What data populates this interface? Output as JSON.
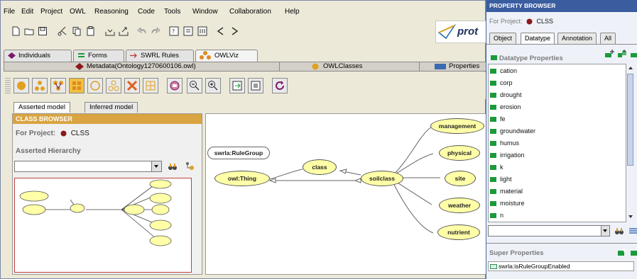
{
  "menu": [
    "File",
    "Edit",
    "Project",
    "OWL",
    "Reasoning",
    "Code",
    "Tools",
    "Window",
    "Collaboration",
    "Help"
  ],
  "logo_text": "prot",
  "tabs": [
    {
      "label": "Individuals",
      "color": "#7a1a6a"
    },
    {
      "label": "Forms",
      "color": "#1a9a3a"
    },
    {
      "label": "SWRL Rules",
      "color": "#c03030"
    },
    {
      "label": "OWLViz",
      "color": "#e08a20"
    }
  ],
  "tabs2": [
    {
      "label": "Metadata(Ontology1270600106.owl)",
      "color": "#8a1a1a"
    },
    {
      "label": "OWLClasses",
      "color": "#e0a020"
    },
    {
      "label": "Properties",
      "color": "#3a6ab0"
    }
  ],
  "subtabs": [
    "Asserted model",
    "Inferred model"
  ],
  "class_browser": {
    "title": "CLASS BROWSER",
    "project_prefix": "For Project:",
    "project_name": "CLSS",
    "hierarchy_label": "Asserted Hierarchy"
  },
  "graph": {
    "nodes": [
      {
        "label": "management"
      },
      {
        "label": "physical"
      },
      {
        "label": "site"
      },
      {
        "label": "weather"
      },
      {
        "label": "nutrient"
      },
      {
        "label": "soilclass"
      },
      {
        "label": "class"
      },
      {
        "label": "owl:Thing"
      },
      {
        "label": "swrla:RuleGroup"
      }
    ]
  },
  "property_browser": {
    "title": "PROPERTY BROWSER",
    "project_prefix": "For Project:",
    "project_name": "CLSS",
    "tabs": [
      "Object",
      "Datatype",
      "Annotation",
      "All"
    ],
    "active_tab": "Datatype",
    "section_label": "Datatype Properties",
    "items": [
      "cation",
      "corp",
      "drought",
      "erosion",
      "fe",
      "groundwater",
      "humus",
      "irrigation",
      "k",
      "light",
      "material",
      "moisture",
      "n"
    ],
    "super_label": "Super Properties",
    "super_items": [
      "swrla:isRuleGroupEnabled"
    ]
  }
}
